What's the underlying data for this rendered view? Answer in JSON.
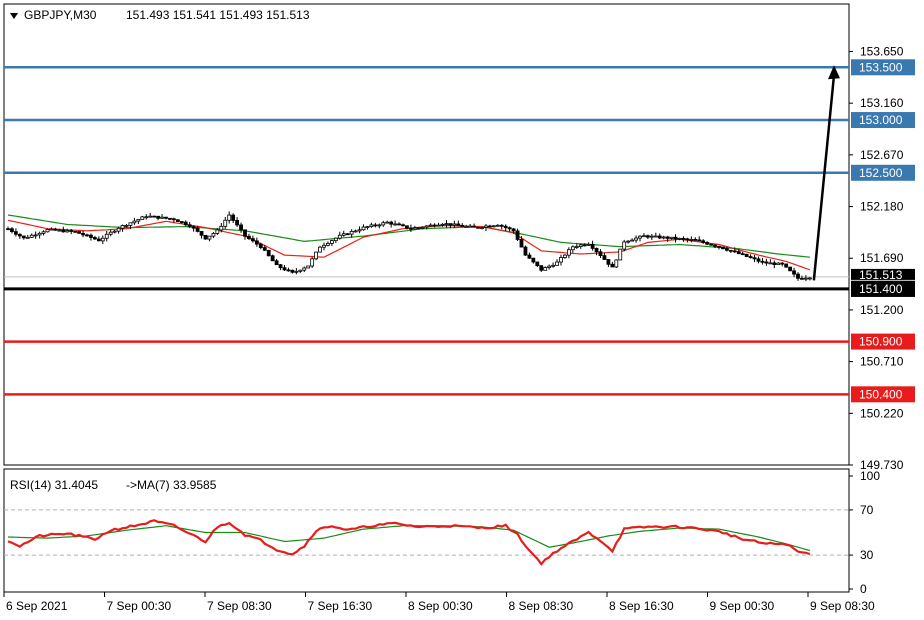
{
  "header": {
    "symbol": "GBPJPY,M30",
    "ohlc": "151.493 151.541 151.493 151.513"
  },
  "rsi_header": {
    "label": "RSI(14) 31.4045",
    "ma_label": "->MA(7) 33.9585"
  },
  "colors": {
    "background": "#ffffff",
    "candle": "#000000",
    "ma_fast": "#e8231c",
    "ma_slow": "#1a8a1a",
    "resistance": "#3a78b0",
    "support": "#e81c1c",
    "pivot": "#000000",
    "rsi": "#e81c1c",
    "rsi_ma": "#1a8a1a"
  },
  "chart_data": [
    {
      "type": "candlestick",
      "ylim": [
        149.73,
        154.1
      ],
      "y_ticks": [
        "153.650",
        "153.160",
        "152.670",
        "152.180",
        "151.690",
        "151.200",
        "150.710",
        "150.220",
        "149.730"
      ],
      "x_ticks": [
        "6 Sep 2021",
        "7 Sep 00:30",
        "7 Sep 08:30",
        "7 Sep 16:30",
        "8 Sep 00:30",
        "8 Sep 08:30",
        "8 Sep 16:30",
        "9 Sep 00:30",
        "9 Sep 08:30"
      ],
      "current_price": 151.513,
      "current_price_label": "151.513",
      "levels": [
        {
          "value": 153.5,
          "label": "153.500",
          "kind": "resistance"
        },
        {
          "value": 153.0,
          "label": "153.000",
          "kind": "resistance"
        },
        {
          "value": 152.5,
          "label": "152.500",
          "kind": "resistance"
        },
        {
          "value": 151.4,
          "label": "151.400",
          "kind": "pivot"
        },
        {
          "value": 150.9,
          "label": "150.900",
          "kind": "support"
        },
        {
          "value": 150.4,
          "label": "150.400",
          "kind": "support"
        }
      ],
      "arrow": {
        "from": 151.48,
        "to": 153.5
      },
      "price_keys": [
        [
          0,
          151.97
        ],
        [
          4,
          151.88
        ],
        [
          10,
          151.96
        ],
        [
          17,
          151.94
        ],
        [
          23,
          151.86
        ],
        [
          28,
          151.98
        ],
        [
          35,
          152.09
        ],
        [
          42,
          152.06
        ],
        [
          46,
          152.0
        ],
        [
          50,
          151.88
        ],
        [
          53,
          151.95
        ],
        [
          56,
          152.1
        ],
        [
          60,
          151.9
        ],
        [
          64,
          151.8
        ],
        [
          68,
          151.62
        ],
        [
          72,
          151.55
        ],
        [
          76,
          151.62
        ],
        [
          79,
          151.8
        ],
        [
          84,
          151.9
        ],
        [
          90,
          151.98
        ],
        [
          96,
          152.03
        ],
        [
          102,
          151.97
        ],
        [
          110,
          152.02
        ],
        [
          118,
          151.98
        ],
        [
          124,
          152.01
        ],
        [
          128,
          151.95
        ],
        [
          131,
          151.72
        ],
        [
          135,
          151.58
        ],
        [
          139,
          151.65
        ],
        [
          143,
          151.8
        ],
        [
          147,
          151.83
        ],
        [
          150,
          151.72
        ],
        [
          153,
          151.6
        ],
        [
          156,
          151.85
        ],
        [
          161,
          151.9
        ],
        [
          168,
          151.88
        ],
        [
          174,
          151.86
        ],
        [
          180,
          151.8
        ],
        [
          186,
          151.72
        ],
        [
          191,
          151.65
        ],
        [
          196,
          151.63
        ],
        [
          200,
          151.5
        ],
        [
          203,
          151.513
        ]
      ],
      "ma_fast_keys": [
        [
          0,
          152.05
        ],
        [
          10,
          151.97
        ],
        [
          20,
          151.95
        ],
        [
          30,
          151.97
        ],
        [
          40,
          152.04
        ],
        [
          50,
          151.98
        ],
        [
          60,
          151.9
        ],
        [
          70,
          151.72
        ],
        [
          80,
          151.7
        ],
        [
          90,
          151.89
        ],
        [
          100,
          151.97
        ],
        [
          110,
          152.0
        ],
        [
          120,
          151.99
        ],
        [
          128,
          151.93
        ],
        [
          135,
          151.76
        ],
        [
          145,
          151.73
        ],
        [
          155,
          151.75
        ],
        [
          162,
          151.84
        ],
        [
          170,
          151.87
        ],
        [
          180,
          151.82
        ],
        [
          190,
          151.72
        ],
        [
          197,
          151.66
        ],
        [
          203,
          151.58
        ]
      ],
      "ma_slow_keys": [
        [
          0,
          152.1
        ],
        [
          15,
          152.01
        ],
        [
          30,
          151.98
        ],
        [
          45,
          151.99
        ],
        [
          60,
          151.95
        ],
        [
          75,
          151.85
        ],
        [
          90,
          151.9
        ],
        [
          105,
          151.97
        ],
        [
          120,
          151.99
        ],
        [
          130,
          151.92
        ],
        [
          140,
          151.84
        ],
        [
          155,
          151.8
        ],
        [
          170,
          151.82
        ],
        [
          185,
          151.78
        ],
        [
          195,
          151.73
        ],
        [
          203,
          151.7
        ]
      ]
    },
    {
      "type": "line",
      "name": "RSI(14)",
      "ylim": [
        0,
        100
      ],
      "y_ticks": [
        "100",
        "70",
        "30",
        "0"
      ],
      "dashed_levels": [
        70,
        30
      ],
      "rsi_keys": [
        [
          0,
          43
        ],
        [
          3,
          38
        ],
        [
          8,
          47
        ],
        [
          15,
          49
        ],
        [
          22,
          44
        ],
        [
          26,
          52
        ],
        [
          32,
          56
        ],
        [
          37,
          60
        ],
        [
          42,
          56
        ],
        [
          46,
          49
        ],
        [
          50,
          42
        ],
        [
          53,
          55
        ],
        [
          56,
          59
        ],
        [
          60,
          48
        ],
        [
          64,
          43
        ],
        [
          68,
          35
        ],
        [
          72,
          31
        ],
        [
          75,
          38
        ],
        [
          78,
          52
        ],
        [
          82,
          56
        ],
        [
          86,
          52
        ],
        [
          92,
          56
        ],
        [
          98,
          58
        ],
        [
          104,
          55
        ],
        [
          112,
          56
        ],
        [
          120,
          54
        ],
        [
          126,
          56
        ],
        [
          129,
          48
        ],
        [
          132,
          34
        ],
        [
          135,
          23
        ],
        [
          139,
          34
        ],
        [
          143,
          42
        ],
        [
          147,
          50
        ],
        [
          150,
          43
        ],
        [
          153,
          34
        ],
        [
          156,
          53
        ],
        [
          162,
          55
        ],
        [
          170,
          55
        ],
        [
          176,
          53
        ],
        [
          181,
          50
        ],
        [
          186,
          44
        ],
        [
          192,
          40
        ],
        [
          197,
          40
        ],
        [
          200,
          33
        ],
        [
          203,
          31
        ]
      ],
      "rsi_ma_keys": [
        [
          0,
          46
        ],
        [
          10,
          45
        ],
        [
          20,
          47
        ],
        [
          30,
          52
        ],
        [
          40,
          56
        ],
        [
          50,
          50
        ],
        [
          60,
          50
        ],
        [
          70,
          42
        ],
        [
          80,
          45
        ],
        [
          90,
          53
        ],
        [
          100,
          56
        ],
        [
          110,
          56
        ],
        [
          120,
          55
        ],
        [
          128,
          52
        ],
        [
          137,
          37
        ],
        [
          145,
          42
        ],
        [
          152,
          47
        ],
        [
          160,
          51
        ],
        [
          170,
          54
        ],
        [
          180,
          53
        ],
        [
          190,
          46
        ],
        [
          197,
          40
        ],
        [
          203,
          34
        ]
      ]
    }
  ]
}
